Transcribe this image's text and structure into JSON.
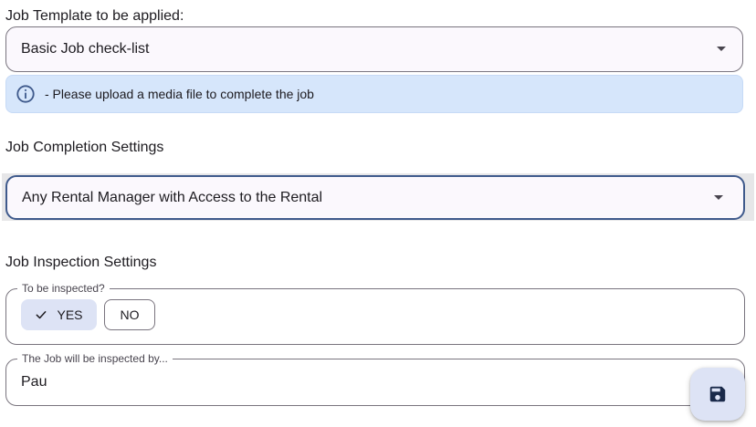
{
  "job_template": {
    "label": "Job Template to be applied:",
    "selected": "Basic Job check-list",
    "info_message": "- Please upload a media file to complete the job"
  },
  "job_completion": {
    "label": "Job Completion Settings",
    "selected": "Any Rental Manager with Access to the Rental"
  },
  "job_inspection": {
    "label": "Job Inspection Settings",
    "to_be_inspected_legend": "To be inspected?",
    "yes_label": "YES",
    "no_label": "NO",
    "yes_selected": true,
    "inspected_by_legend": "The Job will be inspected by...",
    "inspected_by_value": "Pau"
  },
  "icons": {
    "info": "info-icon",
    "dropdown": "dropdown-caret-icon",
    "check": "check-icon",
    "save": "save-icon"
  },
  "colors": {
    "accent": "#3f5a8c",
    "info_bg": "#d6e6fb",
    "selected_bg": "#dde3f5",
    "outline": "#79747e"
  }
}
